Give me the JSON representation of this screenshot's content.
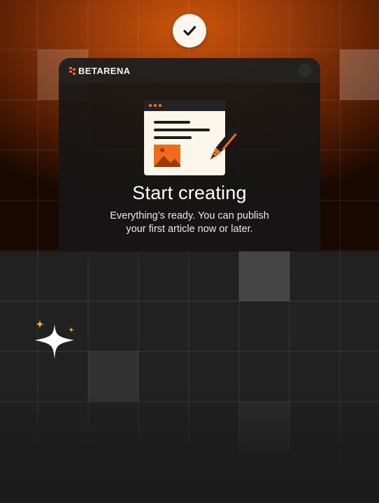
{
  "brand": {
    "name": "BETARENA",
    "accent_color": "#f26a1b"
  },
  "status_icon": "checkmark-icon",
  "illustration_icon": "article-with-pen-icon",
  "decor_icon": "sparkles-icon",
  "content": {
    "title": "Start creating",
    "subtitle_line1": "Everything’s ready. You can publish",
    "subtitle_line2": "your first article now or later."
  },
  "colors": {
    "background": "#1b1b1b",
    "glow": "#d6580a",
    "paper": "#fbf6ea",
    "accent": "#f26a1b"
  }
}
